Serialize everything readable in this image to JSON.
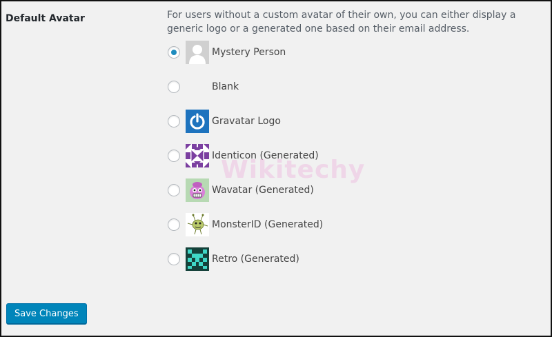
{
  "section": {
    "label": "Default Avatar",
    "description": "For users without a custom avatar of their own, you can either display a generic logo or a generated one based on their email address."
  },
  "options": [
    {
      "label": "Mystery Person",
      "icon": "mystery-person-avatar-icon",
      "checked": true
    },
    {
      "label": "Blank",
      "icon": "blank-avatar",
      "checked": false
    },
    {
      "label": "Gravatar Logo",
      "icon": "gravatar-logo-icon",
      "checked": false
    },
    {
      "label": "Identicon (Generated)",
      "icon": "identicon-avatar-icon",
      "checked": false
    },
    {
      "label": "Wavatar (Generated)",
      "icon": "wavatar-avatar-icon",
      "checked": false
    },
    {
      "label": "MonsterID (Generated)",
      "icon": "monsterid-avatar-icon",
      "checked": false
    },
    {
      "label": "Retro (Generated)",
      "icon": "retro-avatar-icon",
      "checked": false
    }
  ],
  "buttons": {
    "save_label": "Save Changes"
  },
  "watermark": "Wikitechy",
  "colors": {
    "accent": "#1e8cbe",
    "button": "#0085ba",
    "panel_bg": "#f1f1f1",
    "gravatar_blue": "#1e73be"
  }
}
